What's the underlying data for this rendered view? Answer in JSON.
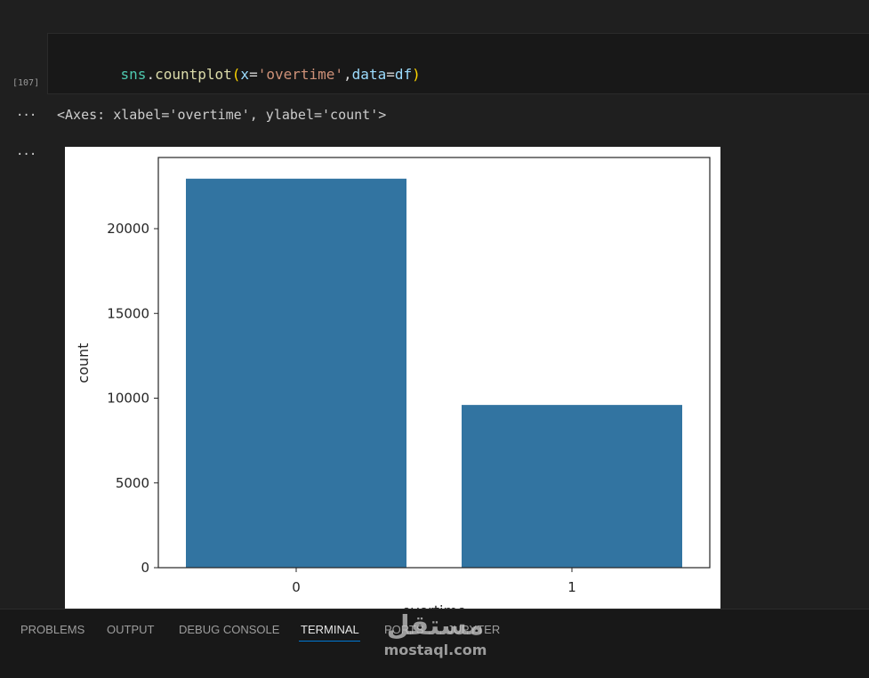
{
  "cell": {
    "execution_count": "[107]",
    "code_tokens": [
      {
        "text": "sns",
        "kind": "var"
      },
      {
        "text": ".",
        "kind": "punc"
      },
      {
        "text": "countplot",
        "kind": "fn"
      },
      {
        "text": "(",
        "kind": "paren"
      },
      {
        "text": "x",
        "kind": "param"
      },
      {
        "text": "=",
        "kind": "punc"
      },
      {
        "text": "'overtime'",
        "kind": "str"
      },
      {
        "text": ",",
        "kind": "punc"
      },
      {
        "text": "data",
        "kind": "param"
      },
      {
        "text": "=",
        "kind": "punc"
      },
      {
        "text": "df",
        "kind": "param"
      },
      {
        "text": ")",
        "kind": "paren"
      }
    ],
    "output_marker": "···",
    "output_text": "<Axes: xlabel='overtime', ylabel='count'>"
  },
  "chart_data": {
    "type": "bar",
    "categories": [
      "0",
      "1"
    ],
    "values": [
      22950,
      9600
    ],
    "xlabel": "overtime",
    "ylabel": "count",
    "ylim": [
      0,
      24200
    ],
    "yticks": [
      0,
      5000,
      10000,
      15000,
      20000
    ],
    "ytick_labels": [
      "0",
      "5000",
      "10000",
      "15000",
      "20000"
    ],
    "bar_color": "#3274a1",
    "grid": false
  },
  "panel": {
    "tabs": [
      {
        "label": "PROBLEMS",
        "active": false
      },
      {
        "label": "OUTPUT",
        "active": false
      },
      {
        "label": "DEBUG CONSOLE",
        "active": false
      },
      {
        "label": "TERMINAL",
        "active": true
      },
      {
        "label": "PORTS",
        "active": false
      },
      {
        "label": "JUPYTER",
        "active": false
      }
    ]
  },
  "watermark": {
    "logo": "مستقل",
    "text": "mostaql.com"
  }
}
